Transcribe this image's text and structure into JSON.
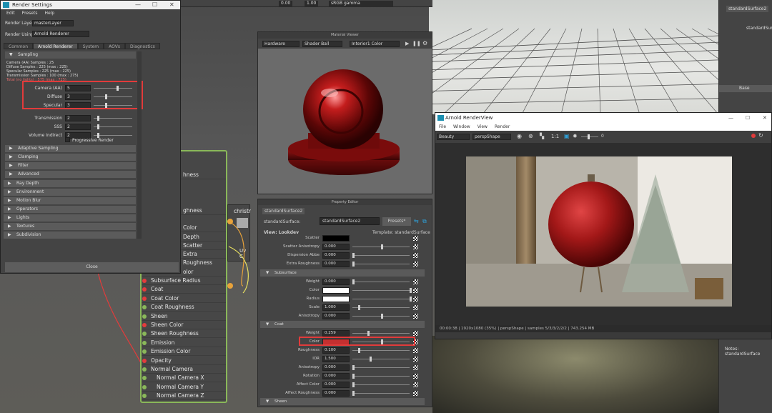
{
  "top_toolbar": {
    "value1": "0.00",
    "value2": "1.00",
    "colorspace": "sRGB gamma"
  },
  "render_settings": {
    "title": "Render Settings",
    "menu": [
      "Edit",
      "Presets",
      "Help"
    ],
    "render_layer_label": "Render Layer",
    "render_layer_value": "masterLayer",
    "render_using_label": "Render Using",
    "render_using_value": "Arnold Renderer",
    "tabs": [
      "Common",
      "Arnold Renderer",
      "System",
      "AOVs",
      "Diagnostics"
    ],
    "sampling_header": "Sampling",
    "info_lines": [
      "Camera (AA) Samples : 25",
      "Diffuse Samples : 225 (max : 225)",
      "Specular Samples : 225 (max : 225)",
      "Transmission Samples : 100 (max : 275)",
      "Total (no lights) : 575 (max : 725)"
    ],
    "params": [
      {
        "label": "Camera (AA)",
        "value": "5"
      },
      {
        "label": "Diffuse",
        "value": "3"
      },
      {
        "label": "Specular",
        "value": "3"
      },
      {
        "label": "Transmission",
        "value": "2"
      },
      {
        "label": "SSS",
        "value": "2"
      },
      {
        "label": "Volume Indirect",
        "value": "2"
      }
    ],
    "progressive_label": "Progressive Render",
    "collapsed_sections": [
      "Adaptive Sampling",
      "Clamping",
      "Filter",
      "Advanced"
    ],
    "outer_sections": [
      "Ray Depth",
      "Environment",
      "Motion Blur",
      "Operators",
      "Lights",
      "Textures",
      "Subdivision"
    ],
    "close_label": "Close"
  },
  "node_panel": {
    "partial_labels": [
      "hness",
      "ghness",
      "Color",
      "Depth",
      "Scatter",
      "Extra Roughness",
      "olor"
    ],
    "rows": [
      {
        "label": "Subsurface Radius",
        "port": "red"
      },
      {
        "label": "Coat",
        "port": "red"
      },
      {
        "label": "Coat Color",
        "port": "red"
      },
      {
        "label": "Coat Roughness",
        "port": "green"
      },
      {
        "label": "Sheen",
        "port": "green"
      },
      {
        "label": "Sheen Color",
        "port": "red"
      },
      {
        "label": "Sheen Roughness",
        "port": "green"
      },
      {
        "label": "Emission",
        "port": "green"
      },
      {
        "label": "Emission Color",
        "port": "green"
      },
      {
        "label": "Opacity",
        "port": "red"
      },
      {
        "label": "Normal Camera",
        "port": "green"
      },
      {
        "label": "Normal Camera X",
        "port": "green",
        "indent": true
      },
      {
        "label": "Normal Camera Y",
        "port": "green",
        "indent": true
      },
      {
        "label": "Normal Camera Z",
        "port": "green",
        "indent": true
      }
    ],
    "side_node_title": "christr",
    "side_node_label": "Uv C"
  },
  "material_viewer": {
    "title": "Material Viewer",
    "renderer": "Hardware",
    "shape": "Shader Ball",
    "env": "Interior1 Color"
  },
  "property_editor": {
    "title": "Property Editor",
    "tab": "standardSurface2",
    "node_type_label": "standardSurface:",
    "node_name": "standardSurface2",
    "presets": "Presets*",
    "view_label": "View: Lookdev",
    "template_label": "Template: standardSurface",
    "top_rows": [
      {
        "label": "Scatter Anisotropy",
        "value": "0.000"
      },
      {
        "label": "Dispersion Abbe",
        "value": "0.000"
      },
      {
        "label": "Extra Roughness",
        "value": "0.000"
      }
    ],
    "scatter_label": "Scatter",
    "subsurface_section": "Subsurface",
    "subsurface_rows": [
      {
        "label": "Weight",
        "value": "0.000"
      },
      {
        "label": "Color",
        "value": ""
      },
      {
        "label": "Radius",
        "value": ""
      },
      {
        "label": "Scale",
        "value": "1.000"
      },
      {
        "label": "Anisotropy",
        "value": "0.000"
      }
    ],
    "coat_section": "Coat",
    "coat_rows": [
      {
        "label": "Weight",
        "value": "0.259"
      },
      {
        "label": "Color",
        "value": ""
      },
      {
        "label": "Roughness",
        "value": "0.100"
      },
      {
        "label": "IOR",
        "value": "1.500"
      },
      {
        "label": "Anisotropy",
        "value": "0.000"
      },
      {
        "label": "Rotation",
        "value": "0.000"
      },
      {
        "label": "Affect Color",
        "value": "0.000"
      },
      {
        "label": "Affect Roughness",
        "value": "0.000"
      }
    ],
    "sheen_section": "Sheen"
  },
  "render_view": {
    "title": "Arnold RenderView",
    "menu": [
      "File",
      "Window",
      "View",
      "Render"
    ],
    "display": "Beauty",
    "camera": "perspShape",
    "ratio": "1:1",
    "exposure": "0",
    "status": "00:00:38 | 1920x1080 (35%) | perspShape | samples 5/3/3/2/2/2 | 743.254 MB"
  },
  "attr_right": {
    "tab": "standardSurface2",
    "partial_label": "standardSurfac",
    "base_section": "Base",
    "notes": "Notes: standardSurface"
  },
  "colors": {
    "highlight_red": "#e23b3b",
    "port_green": "#8ab85a",
    "port_red": "#e43c3c",
    "coat_color": "#c43030"
  }
}
